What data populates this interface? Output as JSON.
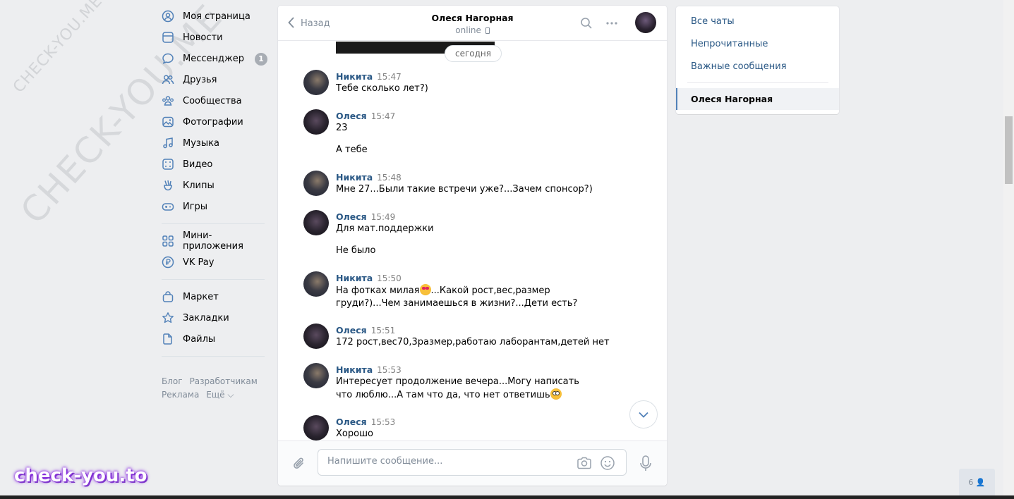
{
  "watermarks": {
    "small": "CHECK-YOU.ME",
    "large": "CHECK-YOU.ME",
    "brand": "check-you.to"
  },
  "leftnav": {
    "items": [
      {
        "label": "Моя страница",
        "icon": "user-circle-icon"
      },
      {
        "label": "Новости",
        "icon": "news-icon"
      },
      {
        "label": "Мессенджер",
        "icon": "chat-bubble-icon",
        "badge": "1"
      },
      {
        "label": "Друзья",
        "icon": "friends-icon"
      },
      {
        "label": "Сообщества",
        "icon": "communities-icon"
      },
      {
        "label": "Фотографии",
        "icon": "photo-icon"
      },
      {
        "label": "Музыка",
        "icon": "music-note-icon"
      },
      {
        "label": "Видео",
        "icon": "video-icon"
      },
      {
        "label": "Клипы",
        "icon": "clips-icon"
      },
      {
        "label": "Игры",
        "icon": "gamepad-icon"
      }
    ],
    "items2": [
      {
        "label": "Мини-приложения",
        "icon": "apps-grid-icon"
      },
      {
        "label": "VK Pay",
        "icon": "vkpay-icon"
      }
    ],
    "items3": [
      {
        "label": "Маркет",
        "icon": "market-bag-icon"
      },
      {
        "label": "Закладки",
        "icon": "star-icon"
      },
      {
        "label": "Файлы",
        "icon": "file-icon"
      }
    ],
    "footer": {
      "blog": "Блог",
      "dev": "Разработчикам",
      "ads": "Реклама",
      "more": "Ещё ⌵"
    }
  },
  "chat": {
    "back": "Назад",
    "peer_name": "Олеся Нагорная",
    "peer_status": "online",
    "date_label": "сегодня",
    "messages": [
      {
        "author": "Никита",
        "time": "15:47",
        "lines": [
          "Тебе сколько лет?)"
        ]
      },
      {
        "author": "Олеся",
        "time": "15:47",
        "lines": [
          "23",
          "А тебе"
        ]
      },
      {
        "author": "Никита",
        "time": "15:48",
        "lines": [
          "Мне 27...Были такие встречи уже?...Зачем спонсор?)"
        ]
      },
      {
        "author": "Олеся",
        "time": "15:49",
        "lines": [
          "Для мат.поддержки",
          "Не было"
        ]
      },
      {
        "author": "Никита",
        "time": "15:50",
        "text_a": "На фотках милая",
        "text_b": "...Какой рост,вес,размер груди?)...Чем занимаешься в жизни?...Дети есть?"
      },
      {
        "author": "Олеся",
        "time": "15:51",
        "lines": [
          "172 рост,вес70,3размер,работаю лаборантам,детей нет"
        ]
      },
      {
        "author": "Никита",
        "time": "15:53",
        "text_a": "Интересует продолжение вечера...Могу написать что люблю...А там что да, что нет ответишь"
      },
      {
        "author": "Олеся",
        "time": "15:53",
        "lines": [
          "Хорошо"
        ]
      }
    ],
    "compose_placeholder": "Напишите сообщение..."
  },
  "rightpanel": {
    "all_chats": "Все чаты",
    "unread": "Непрочитанные",
    "important": "Важные сообщения",
    "active_chat": "Олеся Нагорная"
  },
  "online_count": "6"
}
